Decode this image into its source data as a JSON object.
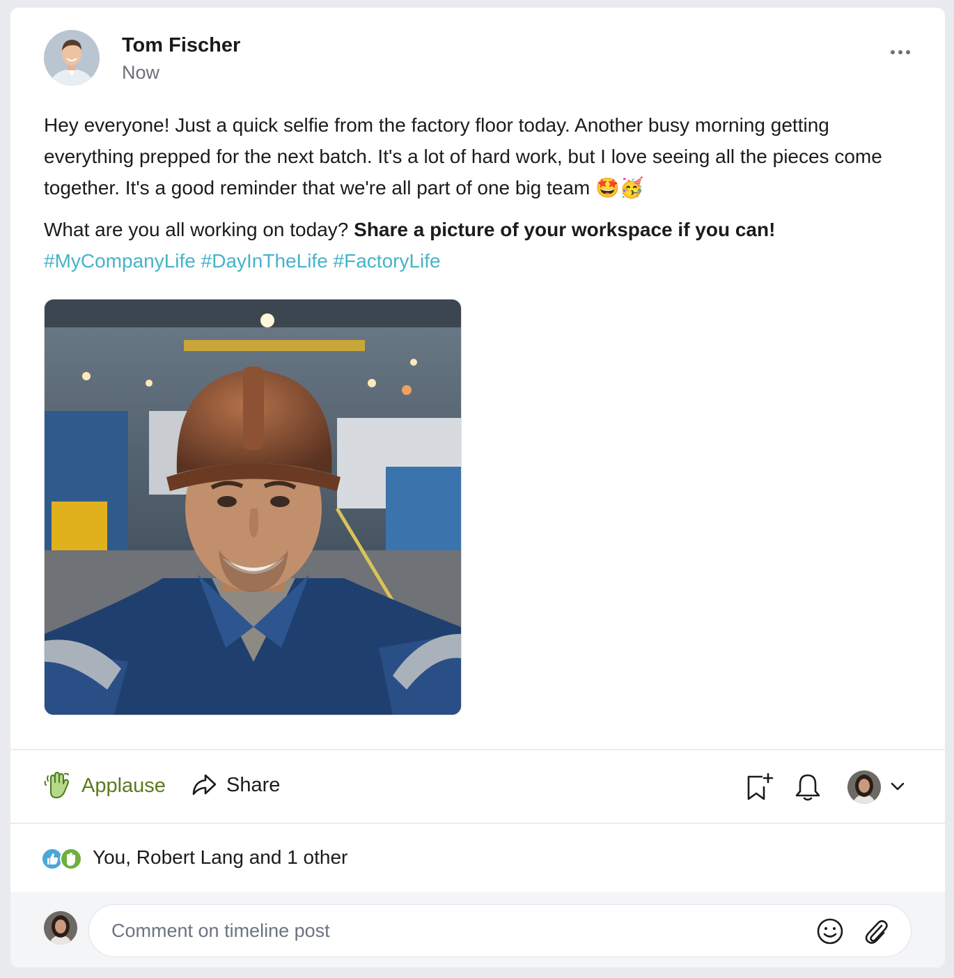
{
  "post": {
    "author": "Tom Fischer",
    "time": "Now",
    "body_line": "Hey everyone! Just a quick selfie from the factory floor today. Another busy morning getting everything prepped for the next batch. It's a lot of hard work, but I love seeing all the pieces come together. It's a good reminder that we're all part of one big team 🤩🥳",
    "question": "What are you all working on today? ",
    "question_bold": "Share a picture of your workspace if you can!",
    "hashtags": [
      "#MyCompanyLife",
      "#DayInTheLife",
      "#FactoryLife"
    ]
  },
  "actions": {
    "applause_label": "Applause",
    "share_label": "Share"
  },
  "reactions": {
    "summary": "You, Robert Lang and 1 other"
  },
  "comment": {
    "placeholder": "Comment on timeline post"
  },
  "icons": {
    "more": "more-horizontal-icon",
    "applause": "clapping-hands-icon",
    "share": "share-arrow-icon",
    "bookmark": "bookmark-add-icon",
    "notify": "bell-icon",
    "dropdown": "chevron-down-icon",
    "emoji": "smiley-icon",
    "attach": "paperclip-icon",
    "like_reaction": "thumbs-up-icon",
    "applause_reaction": "clapping-hands-icon"
  },
  "colors": {
    "applause": "#5b7a1f",
    "hashtag": "#46b3c9",
    "like_badge": "#4aa8d8",
    "applause_badge": "#6fae3f"
  }
}
